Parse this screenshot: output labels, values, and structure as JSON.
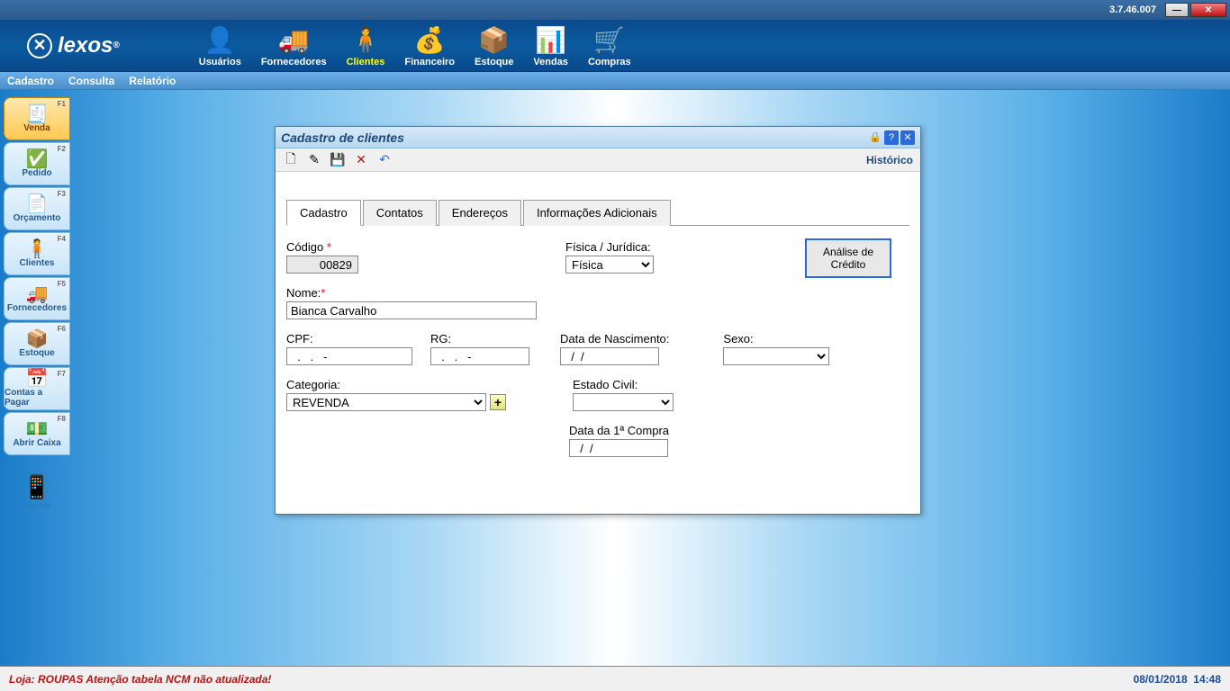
{
  "app": {
    "version": "3.7.46.007",
    "logo": "lexos"
  },
  "topnav": {
    "items": [
      {
        "label": "Usuários"
      },
      {
        "label": "Fornecedores"
      },
      {
        "label": "Clientes"
      },
      {
        "label": "Financeiro"
      },
      {
        "label": "Estoque"
      },
      {
        "label": "Vendas"
      },
      {
        "label": "Compras"
      }
    ]
  },
  "menubar": {
    "items": [
      "Cadastro",
      "Consulta",
      "Relatório"
    ]
  },
  "sidebar": {
    "items": [
      {
        "label": "Venda",
        "key": "F1"
      },
      {
        "label": "Pedido",
        "key": "F2"
      },
      {
        "label": "Orçamento",
        "key": "F3"
      },
      {
        "label": "Clientes",
        "key": "F4"
      },
      {
        "label": "Fornecedores",
        "key": "F5"
      },
      {
        "label": "Estoque",
        "key": "F6"
      },
      {
        "label": "Contas a Pagar",
        "key": "F7"
      },
      {
        "label": "Abrir Caixa",
        "key": "F8"
      }
    ],
    "support": "Suporte"
  },
  "window": {
    "title": "Cadastro de clientes",
    "historico": "Histórico",
    "tabs": [
      "Cadastro",
      "Contatos",
      "Endereços",
      "Informações Adicionais"
    ],
    "labels": {
      "codigo": "Código",
      "fisica_juridica": "Física / Jurídica:",
      "nome": "Nome:",
      "cpf": "CPF:",
      "rg": "RG:",
      "data_nascimento": "Data de Nascimento:",
      "sexo": "Sexo:",
      "categoria": "Categoria:",
      "estado_civil": "Estado Civil:",
      "data_1a_compra": "Data da 1ª Compra"
    },
    "values": {
      "codigo": "00829",
      "fisica_juridica": "Física",
      "nome": "Bianca Carvalho",
      "cpf": "  .   .   -",
      "rg": "  .   .   -",
      "data_nascimento": "  /  /",
      "sexo": "",
      "categoria": "REVENDA",
      "estado_civil": "",
      "data_1a_compra": "  /  /"
    },
    "analise_btn": "Análise de Crédito"
  },
  "status": {
    "left": "Loja: ROUPAS   Atenção tabela NCM não atualizada!",
    "date": "08/01/2018",
    "time": "14:48"
  }
}
